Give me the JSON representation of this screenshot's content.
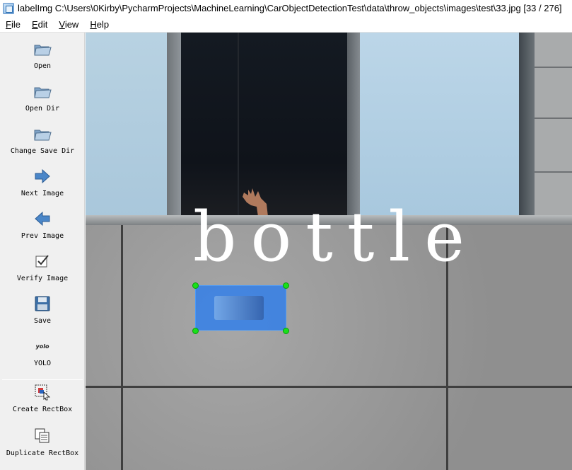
{
  "window": {
    "title": "labelImg C:\\Users\\0Kirby\\PycharmProjects\\MachineLearning\\CarObjectDetectionTest\\data\\throw_objects\\images\\test\\33.jpg [33 / 276]",
    "app_icon": "labelimg-icon"
  },
  "menu": {
    "file": "File",
    "edit": "Edit",
    "view": "View",
    "help": "Help"
  },
  "tools": {
    "open": {
      "label": "Open",
      "icon": "folder-icon"
    },
    "open_dir": {
      "label": "Open Dir",
      "icon": "folder-icon"
    },
    "change_save_dir": {
      "label": "Change Save Dir",
      "icon": "folder-icon"
    },
    "next_image": {
      "label": "Next Image",
      "icon": "arrow-right-icon"
    },
    "prev_image": {
      "label": "Prev Image",
      "icon": "arrow-left-icon"
    },
    "verify_image": {
      "label": "Verify Image",
      "icon": "checkbox-icon"
    },
    "save": {
      "label": "Save",
      "icon": "floppy-icon"
    },
    "yolo": {
      "label": "YOLO",
      "icon_text": "yolo"
    },
    "create_rectbox": {
      "label": "Create RectBox",
      "icon": "create-rect-icon"
    },
    "duplicate_rectbox": {
      "label": "Duplicate RectBox",
      "icon": "duplicate-rect-icon"
    }
  },
  "canvas": {
    "annotation": {
      "label": "bottle",
      "fill_color": "#1e78f5",
      "handle_color": "#19e019"
    }
  }
}
